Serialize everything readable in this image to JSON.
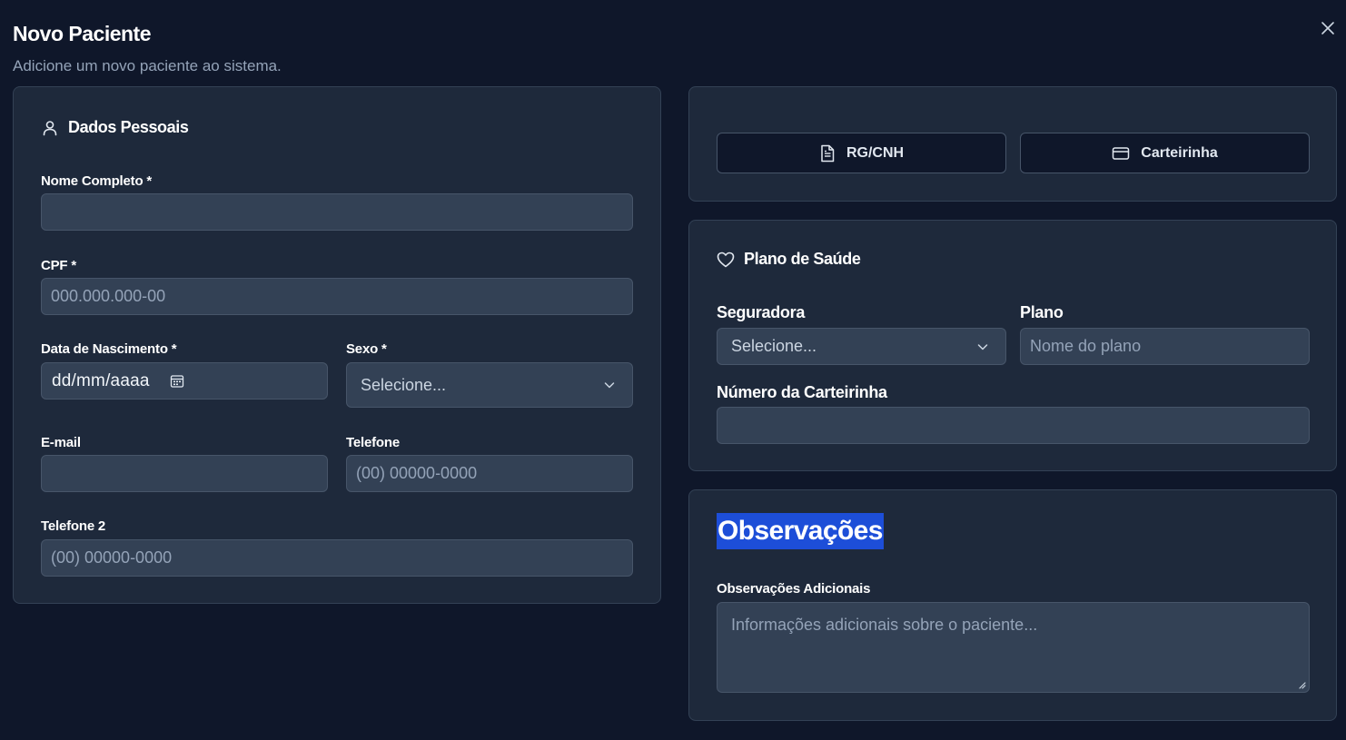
{
  "dialog": {
    "title": "Novo Paciente",
    "subtitle": "Adicione um novo paciente ao sistema."
  },
  "personal": {
    "title": "Dados Pessoais",
    "name_label": "Nome Completo *",
    "name_value": "",
    "cpf_label": "CPF *",
    "cpf_placeholder": "000.000.000-00",
    "birth_label": "Data de Nascimento *",
    "birth_value": "dd/mm/aaaa",
    "sex_label": "Sexo *",
    "sex_value": "Selecione...",
    "email_label": "E-mail",
    "email_value": "",
    "phone_label": "Telefone",
    "phone_placeholder": "(00) 00000-0000",
    "phone2_label": "Telefone 2",
    "phone2_placeholder": "(00) 00000-0000"
  },
  "documents": {
    "rg_label": "RG/CNH",
    "card_label": "Carteirinha"
  },
  "insurance": {
    "title": "Plano de Saúde",
    "insurer_label": "Seguradora",
    "insurer_value": "Selecione...",
    "plan_label": "Plano",
    "plan_placeholder": "Nome do plano",
    "card_number_label": "Número da Carteirinha",
    "card_number_value": ""
  },
  "notes": {
    "title": "Observações",
    "label": "Observações Adicionais",
    "placeholder": "Informações adicionais sobre o paciente..."
  },
  "icons": {
    "close": "close-icon",
    "personal": "user-icon",
    "calendar": "calendar-icon",
    "chevron": "chevron-down-icon",
    "rg": "file-text-icon",
    "card": "credit-card-icon",
    "insurance": "heart-icon"
  },
  "colors": {
    "background": "#0f172a",
    "card": "#1e293b",
    "input": "#334155",
    "border": "#475569",
    "selection": "#1d4ed8"
  }
}
